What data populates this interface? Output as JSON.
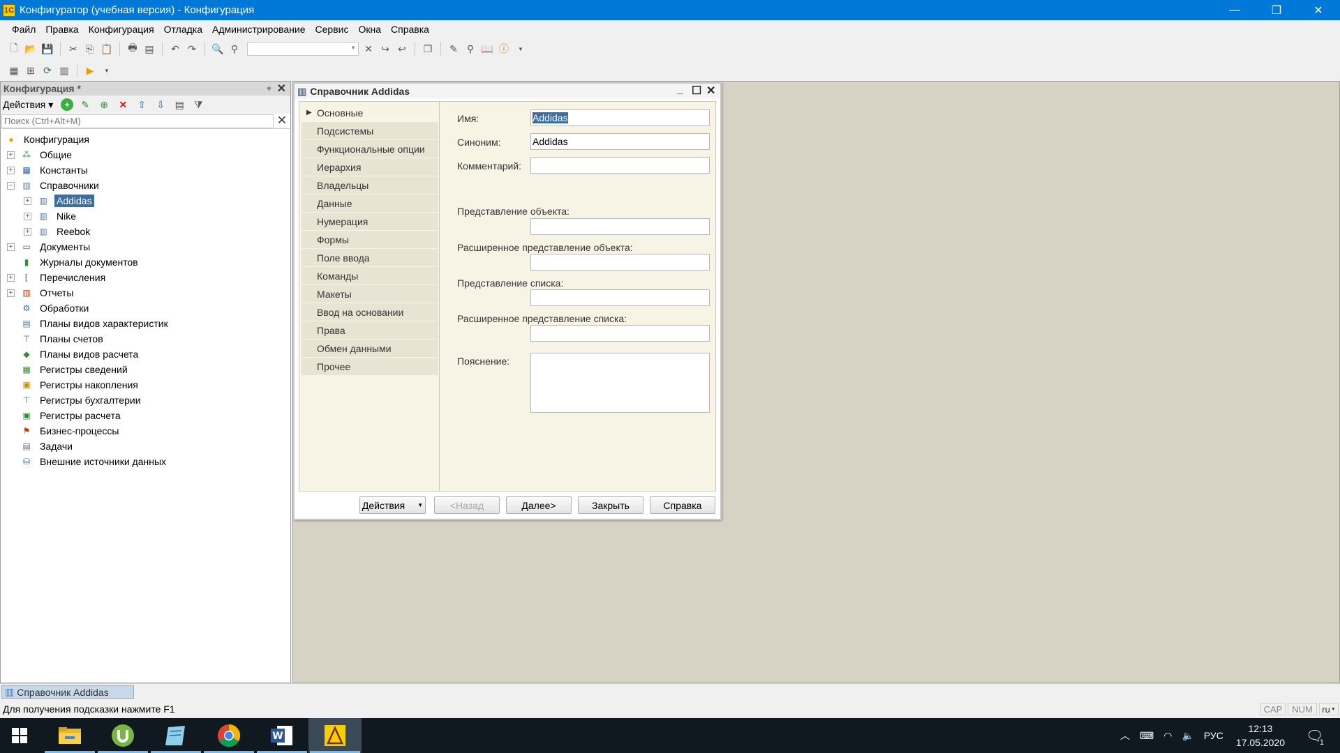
{
  "window": {
    "title": "Конфигуратор (учебная версия) - Конфигурация",
    "app_icon": "1c-logo-icon",
    "minimize": "—",
    "restore": "❐",
    "close": "✕"
  },
  "menu": {
    "items": [
      "Файл",
      "Правка",
      "Конфигурация",
      "Отладка",
      "Администрирование",
      "Сервис",
      "Окна",
      "Справка"
    ]
  },
  "config_panel": {
    "title": "Конфигурация *",
    "actions_label": "Действия",
    "search_placeholder": "Поиск (Ctrl+Alt+M)",
    "tree": [
      {
        "label": "Конфигурация",
        "icon": "config-root-icon",
        "level": 0
      },
      {
        "label": "Общие",
        "icon": "common-icon",
        "level": 1,
        "expandable": true
      },
      {
        "label": "Константы",
        "icon": "constants-icon",
        "level": 1,
        "expandable": true
      },
      {
        "label": "Справочники",
        "icon": "catalog-icon",
        "level": 1,
        "expanded": true
      },
      {
        "label": "Addidas",
        "icon": "catalog-icon",
        "level": 2,
        "selected": true
      },
      {
        "label": "Nike",
        "icon": "catalog-icon",
        "level": 2
      },
      {
        "label": "Reebok",
        "icon": "catalog-icon",
        "level": 2
      },
      {
        "label": "Документы",
        "icon": "document-icon",
        "level": 1,
        "expandable": true
      },
      {
        "label": "Журналы документов",
        "icon": "journal-icon",
        "level": 1
      },
      {
        "label": "Перечисления",
        "icon": "enum-icon",
        "level": 1,
        "expandable": true
      },
      {
        "label": "Отчеты",
        "icon": "report-icon",
        "level": 1,
        "expandable": true
      },
      {
        "label": "Обработки",
        "icon": "processing-icon",
        "level": 1
      },
      {
        "label": "Планы видов характеристик",
        "icon": "chart-of-characteristics-icon",
        "level": 1
      },
      {
        "label": "Планы счетов",
        "icon": "chart-of-accounts-icon",
        "level": 1
      },
      {
        "label": "Планы видов расчета",
        "icon": "calc-types-icon",
        "level": 1
      },
      {
        "label": "Регистры сведений",
        "icon": "info-register-icon",
        "level": 1
      },
      {
        "label": "Регистры накопления",
        "icon": "accum-register-icon",
        "level": 1
      },
      {
        "label": "Регистры бухгалтерии",
        "icon": "accounting-register-icon",
        "level": 1
      },
      {
        "label": "Регистры расчета",
        "icon": "calc-register-icon",
        "level": 1
      },
      {
        "label": "Бизнес-процессы",
        "icon": "business-process-icon",
        "level": 1
      },
      {
        "label": "Задачи",
        "icon": "task-icon",
        "level": 1
      },
      {
        "label": "Внешние источники данных",
        "icon": "external-data-icon",
        "level": 1
      }
    ]
  },
  "dialog": {
    "title": "Справочник Addidas",
    "tabs": [
      "Основные",
      "Подсистемы",
      "Функциональные опции",
      "Иерархия",
      "Владельцы",
      "Данные",
      "Нумерация",
      "Формы",
      "Поле ввода",
      "Команды",
      "Макеты",
      "Ввод на основании",
      "Права",
      "Обмен данными",
      "Прочее"
    ],
    "active_tab": "Основные",
    "fields": {
      "name_label": "Имя:",
      "name_value": "Addidas",
      "synonym_label": "Синоним:",
      "synonym_value": "Addidas",
      "comment_label": "Комментарий:",
      "comment_value": "",
      "object_presentation_label": "Представление объекта:",
      "ext_object_presentation_label": "Расширенное представление объекта:",
      "list_presentation_label": "Представление списка:",
      "ext_list_presentation_label": "Расширенное представление списка:",
      "explanation_label": "Пояснение:"
    },
    "buttons": {
      "actions": "Действия",
      "back": "<Назад",
      "next": "Далее>",
      "close": "Закрыть",
      "help": "Справка"
    }
  },
  "window_tabs": [
    {
      "label": "Справочник Addidas"
    }
  ],
  "status": {
    "hint": "Для получения подсказки нажмите F1",
    "cap": "CAP",
    "num": "NUM",
    "lang": "ru"
  },
  "taskbar": {
    "apps": [
      "windows-start-icon",
      "file-explorer-icon",
      "utorrent-icon",
      "notepad-icon",
      "chrome-icon",
      "word-icon",
      "1c-icon"
    ],
    "tray_lang": "РУС",
    "time": "12:13",
    "date": "17.05.2020",
    "notifications": "1"
  }
}
